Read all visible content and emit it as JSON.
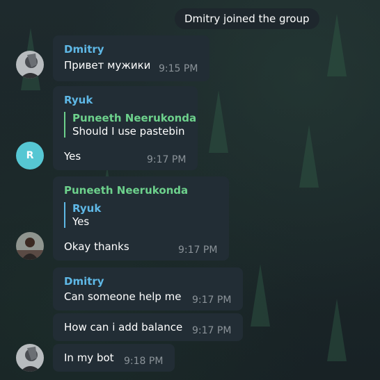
{
  "service_message": "Dmitry joined the group",
  "messages": [
    {
      "sender": "Dmitry",
      "sender_color": "#5fb8e6",
      "text": "Привет мужики",
      "time": "9:15 PM"
    },
    {
      "sender": "Ryuk",
      "sender_color": "#5fb8e6",
      "reply": {
        "name": "Puneeth Neerukonda",
        "text": "Should I use pastebin",
        "color": "#6dd18c"
      },
      "text": "Yes",
      "time": "9:17 PM"
    },
    {
      "sender": "Puneeth Neerukonda",
      "sender_color": "#6dd18c",
      "reply": {
        "name": "Ryuk",
        "text": "Yes",
        "color": "#5fb8e6"
      },
      "text": "Okay thanks",
      "time": "9:17 PM"
    },
    {
      "sender": "Dmitry",
      "sender_color": "#5fb8e6",
      "text": "Can someone help me",
      "time": "9:17 PM"
    },
    {
      "text": "How can i add balance",
      "time": "9:17 PM"
    },
    {
      "text": "In my bot",
      "time": "9:18 PM"
    }
  ],
  "avatars": {
    "ryuk_letter": "R",
    "dmitry_icon": "user-photo",
    "puneeth_icon": "user-photo"
  },
  "colors": {
    "bubble": "#222d35",
    "blue_name": "#5fb8e6",
    "green_name": "#6dd18c",
    "avatar_r": "#56c7d3"
  }
}
